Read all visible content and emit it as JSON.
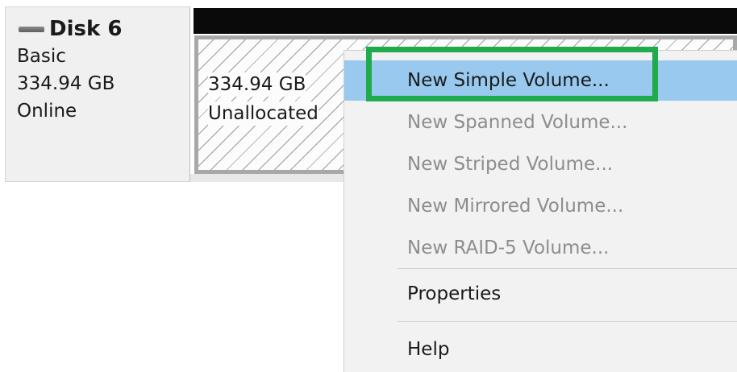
{
  "disk": {
    "name": "Disk 6",
    "type": "Basic",
    "size": "334.94 GB",
    "status": "Online"
  },
  "volume": {
    "size": "334.94 GB",
    "state": "Unallocated"
  },
  "context_menu": {
    "new_simple_volume": "New Simple Volume...",
    "new_spanned_volume": "New Spanned Volume...",
    "new_striped_volume": "New Striped Volume...",
    "new_mirrored_volume": "New Mirrored Volume...",
    "new_raid5_volume": "New RAID-5 Volume...",
    "properties": "Properties",
    "help": "Help"
  },
  "colors": {
    "highlight": "#99c9ef",
    "annotation_box": "#1faa4b",
    "disabled_text": "#8d8d8d"
  },
  "icons": {
    "disk": "disk-drive-icon"
  }
}
